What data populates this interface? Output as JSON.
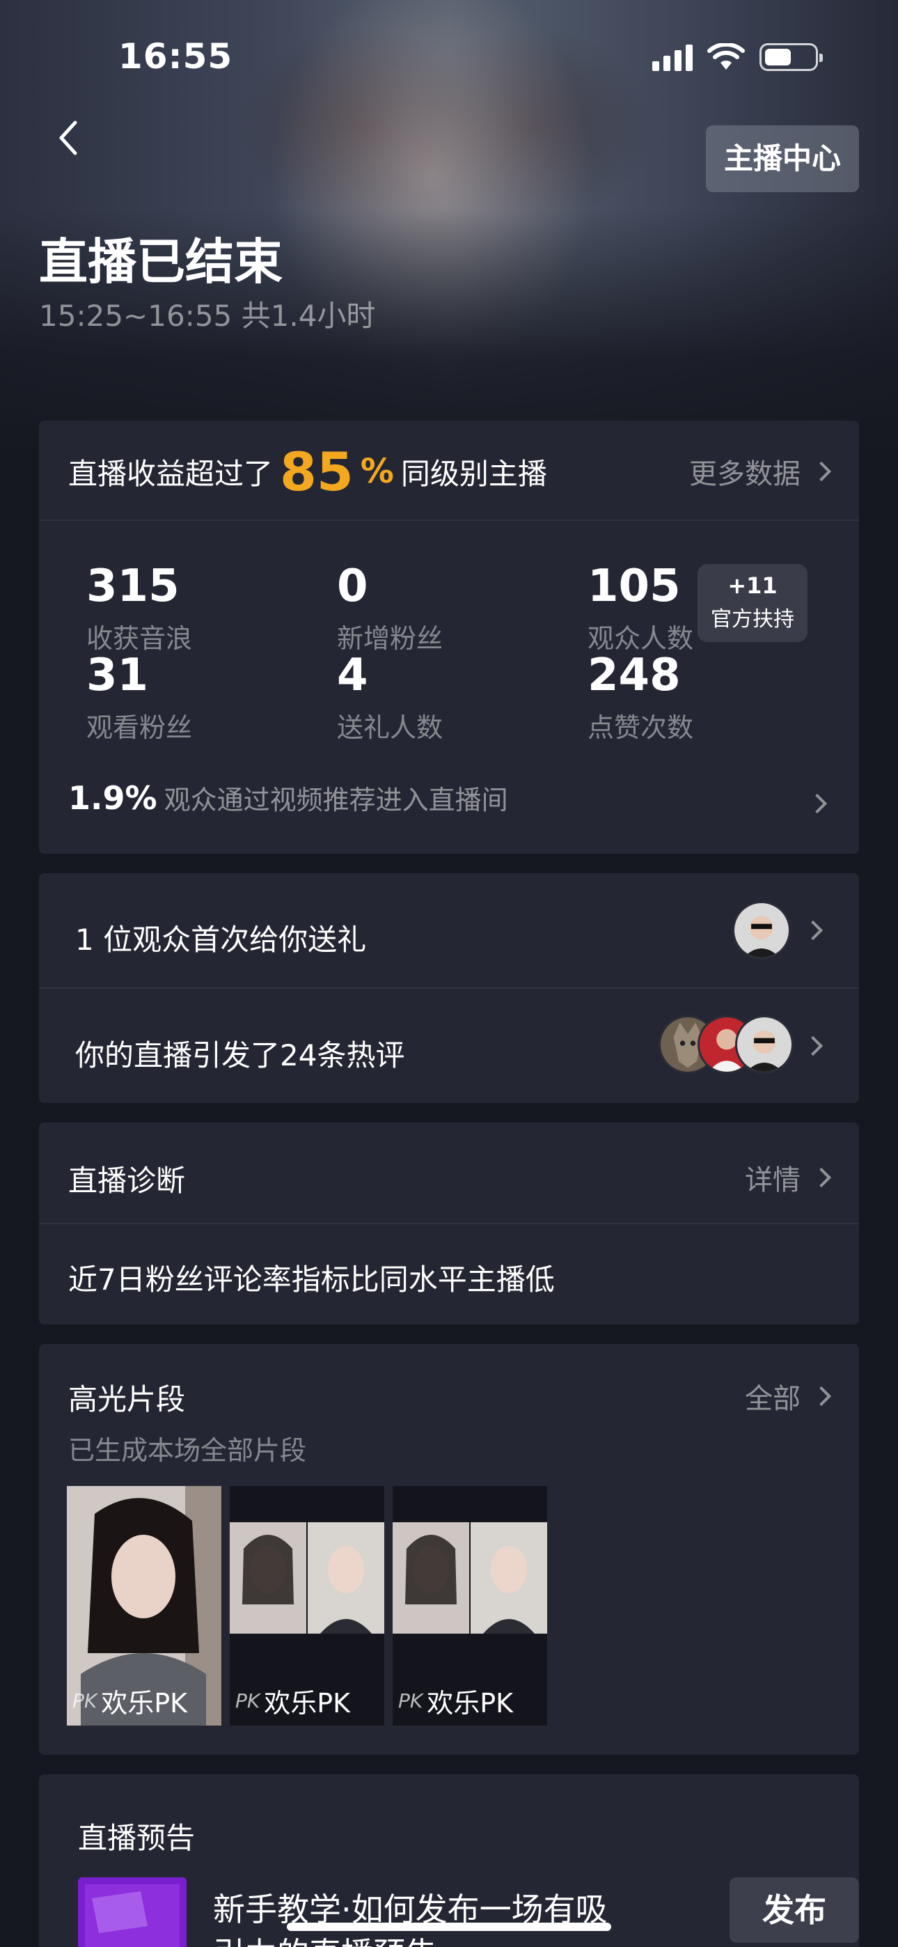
{
  "status_bar": {
    "time": "16:55"
  },
  "nav": {
    "anchor_center_label": "主播中心"
  },
  "header": {
    "title": "直播已结束",
    "time_range": "15:25~16:55 共1.4小时"
  },
  "overview": {
    "rank_prefix": "直播收益超过了",
    "rank_percent": "85",
    "rank_percent_sign": "%",
    "rank_suffix": "同级别主播",
    "more_data_label": "更多数据",
    "stats": [
      {
        "value": "315",
        "label": "收获音浪"
      },
      {
        "value": "0",
        "label": "新增粉丝"
      },
      {
        "value": "105",
        "label": "观众人数"
      },
      {
        "value": "31",
        "label": "观看粉丝"
      },
      {
        "value": "4",
        "label": "送礼人数"
      },
      {
        "value": "248",
        "label": "点赞次数"
      }
    ],
    "boost_badge": {
      "value": "+11",
      "label": "官方扶持"
    },
    "recommend_percent": "1.9%",
    "recommend_text": "观众通过视频推荐进入直播间"
  },
  "highlights_rows": {
    "gift_text": "1 位观众首次给你送礼",
    "comments_text": "你的直播引发了24条热评"
  },
  "diagnosis": {
    "title": "直播诊断",
    "detail_label": "详情",
    "message": "近7日粉丝评论率指标比同水平主播低"
  },
  "clips": {
    "title": "高光片段",
    "all_label": "全部",
    "subtitle": "已生成本场全部片段",
    "items": [
      {
        "pk": "PK",
        "label": "欢乐PK"
      },
      {
        "pk": "PK",
        "label": "欢乐PK"
      },
      {
        "pk": "PK",
        "label": "欢乐PK"
      }
    ]
  },
  "preview": {
    "title": "直播预告",
    "tutorial_line1": "新手教学·如何发布一场有吸",
    "tutorial_line2": "引力的直播预告",
    "publish_label": "发布"
  },
  "colors": {
    "accent": "#f3a81f",
    "card_bg": "#242733",
    "page_bg": "#161821"
  }
}
